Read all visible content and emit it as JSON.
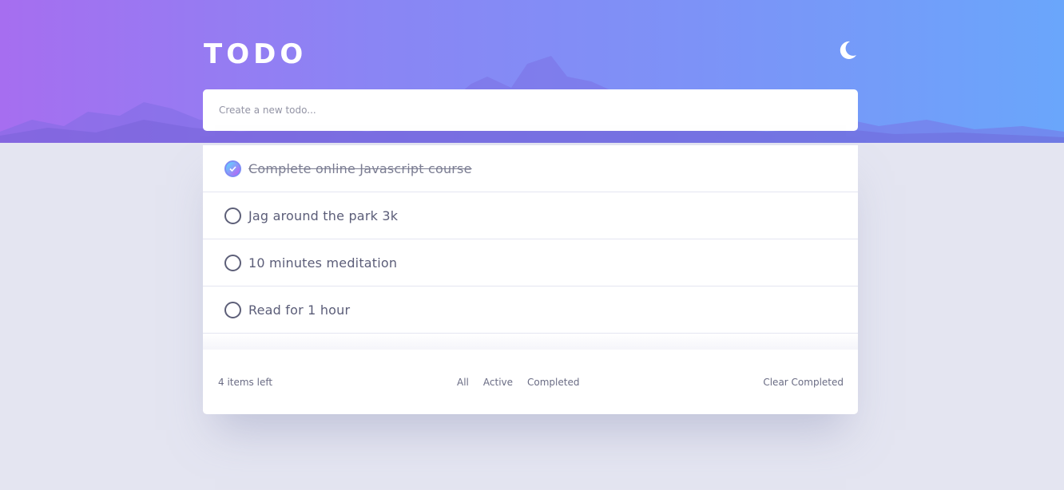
{
  "app": {
    "title": "TODO",
    "theme_icon": "moon-icon"
  },
  "new_todo": {
    "placeholder": "Create a new todo...",
    "value": ""
  },
  "todos": [
    {
      "text": "Complete online Javascript course",
      "completed": true
    },
    {
      "text": "Jag around the park 3k",
      "completed": false
    },
    {
      "text": "10 minutes meditation",
      "completed": false
    },
    {
      "text": "Read for 1 hour",
      "completed": false
    }
  ],
  "footer": {
    "items_left": "4 items left",
    "filters": [
      "All",
      "Active",
      "Completed"
    ],
    "clear_label": "Clear Completed"
  },
  "colors": {
    "gradient_start": "#a66ef0",
    "gradient_end": "#6aa6fb",
    "page_background": "#e4e5f1",
    "card_background": "#ffffff",
    "check_gradient_start": "#57ddff",
    "check_gradient_end": "#c058f3"
  }
}
